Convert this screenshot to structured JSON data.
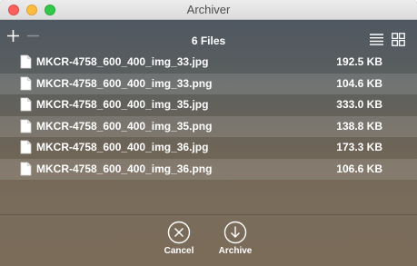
{
  "window": {
    "title": "Archiver"
  },
  "toolbar": {
    "file_count_label": "6 Files",
    "add_icon": "plus-icon",
    "remove_icon": "minus-icon",
    "list_view_icon": "list-view-icon",
    "grid_view_icon": "grid-view-icon"
  },
  "files": [
    {
      "name": "MKCR-4758_600_400_img_33.jpg",
      "size": "192.5 KB"
    },
    {
      "name": "MKCR-4758_600_400_img_33.png",
      "size": "104.6 KB"
    },
    {
      "name": "MKCR-4758_600_400_img_35.jpg",
      "size": "333.0 KB"
    },
    {
      "name": "MKCR-4758_600_400_img_35.png",
      "size": "138.8 KB"
    },
    {
      "name": "MKCR-4758_600_400_img_36.jpg",
      "size": "173.3 KB"
    },
    {
      "name": "MKCR-4758_600_400_img_36.png",
      "size": "106.6 KB"
    }
  ],
  "actions": {
    "cancel_label": "Cancel",
    "archive_label": "Archive"
  },
  "colors": {
    "close": "#fc605c",
    "minimize": "#fdbc40",
    "maximize": "#34c84a",
    "text": "#ffffff"
  }
}
